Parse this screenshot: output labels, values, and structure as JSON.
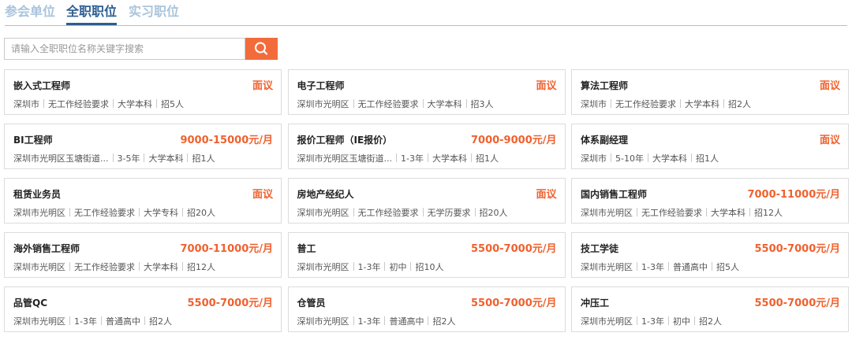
{
  "tabs": [
    {
      "label": "参会单位",
      "active": false
    },
    {
      "label": "全职职位",
      "active": true
    },
    {
      "label": "实习职位",
      "active": false
    }
  ],
  "search": {
    "placeholder": "请输入全职职位名称关键字搜索",
    "value": "",
    "button_icon": "search-icon"
  },
  "colors": {
    "accent": "#f26c3b",
    "salary": "#f0612e",
    "tab_active": "#2b5d91",
    "tab_inactive": "#a9c4dc"
  },
  "jobs": [
    {
      "title": "嵌入式工程师",
      "salary": "面议",
      "location": "深圳市",
      "experience": "无工作经验要求",
      "education": "大学本科",
      "headcount": "招5人"
    },
    {
      "title": "电子工程师",
      "salary": "面议",
      "location": "深圳市光明区",
      "experience": "无工作经验要求",
      "education": "大学本科",
      "headcount": "招3人"
    },
    {
      "title": "算法工程师",
      "salary": "面议",
      "location": "深圳市",
      "experience": "无工作经验要求",
      "education": "大学本科",
      "headcount": "招2人"
    },
    {
      "title": "BI工程师",
      "salary": "9000-15000元/月",
      "location": "深圳市光明区玉塘街道...",
      "experience": "3-5年",
      "education": "大学本科",
      "headcount": "招1人"
    },
    {
      "title": "报价工程师（IE报价）",
      "salary": "7000-9000元/月",
      "location": "深圳市光明区玉塘街道...",
      "experience": "1-3年",
      "education": "大学本科",
      "headcount": "招1人"
    },
    {
      "title": "体系副经理",
      "salary": "面议",
      "location": "深圳市",
      "experience": "5-10年",
      "education": "大学本科",
      "headcount": "招1人"
    },
    {
      "title": "租赁业务员",
      "salary": "面议",
      "location": "深圳市光明区",
      "experience": "无工作经验要求",
      "education": "大学专科",
      "headcount": "招20人"
    },
    {
      "title": "房地产经纪人",
      "salary": "面议",
      "location": "深圳市光明区",
      "experience": "无工作经验要求",
      "education": "无学历要求",
      "headcount": "招20人"
    },
    {
      "title": "国内销售工程师",
      "salary": "7000-11000元/月",
      "location": "深圳市光明区",
      "experience": "无工作经验要求",
      "education": "大学本科",
      "headcount": "招12人"
    },
    {
      "title": "海外销售工程师",
      "salary": "7000-11000元/月",
      "location": "深圳市光明区",
      "experience": "无工作经验要求",
      "education": "大学本科",
      "headcount": "招12人"
    },
    {
      "title": "普工",
      "salary": "5500-7000元/月",
      "location": "深圳市光明区",
      "experience": "1-3年",
      "education": "初中",
      "headcount": "招10人"
    },
    {
      "title": "技工学徒",
      "salary": "5500-7000元/月",
      "location": "深圳市光明区",
      "experience": "1-3年",
      "education": "普通高中",
      "headcount": "招5人"
    },
    {
      "title": "品管QC",
      "salary": "5500-7000元/月",
      "location": "深圳市光明区",
      "experience": "1-3年",
      "education": "普通高中",
      "headcount": "招2人"
    },
    {
      "title": "仓管员",
      "salary": "5500-7000元/月",
      "location": "深圳市光明区",
      "experience": "1-3年",
      "education": "普通高中",
      "headcount": "招2人"
    },
    {
      "title": "冲压工",
      "salary": "5500-7000元/月",
      "location": "深圳市光明区",
      "experience": "1-3年",
      "education": "初中",
      "headcount": "招2人"
    }
  ]
}
